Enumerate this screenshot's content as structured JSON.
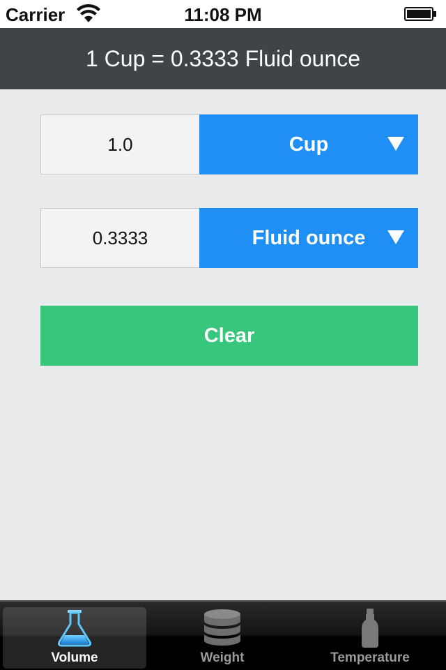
{
  "status_bar": {
    "carrier": "Carrier",
    "time": "11:08 PM"
  },
  "header": {
    "title": "1 Cup = 0.3333 Fluid ounce"
  },
  "converter": {
    "from": {
      "value": "1.0",
      "unit": "Cup"
    },
    "to": {
      "value": "0.3333",
      "unit": "Fluid ounce"
    },
    "clear_label": "Clear"
  },
  "tabs": [
    {
      "label": "Volume",
      "icon": "flask-icon",
      "active": true
    },
    {
      "label": "Weight",
      "icon": "weight-stack-icon",
      "active": false
    },
    {
      "label": "Temperature",
      "icon": "bottle-icon",
      "active": false
    }
  ],
  "colors": {
    "nav_background": "#3e4447",
    "select_blue": "#1f8ef5",
    "clear_green": "#37c67b",
    "page_background": "#e8eaeb"
  }
}
